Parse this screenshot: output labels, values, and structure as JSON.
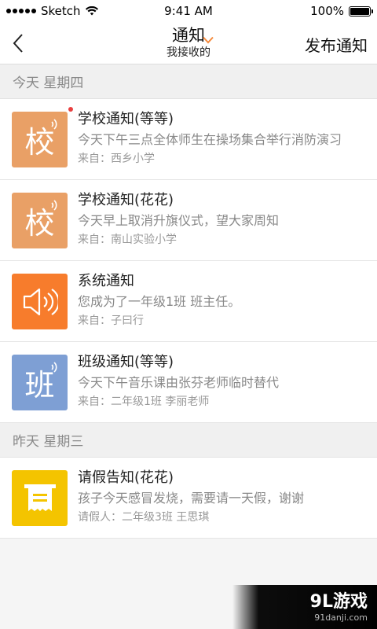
{
  "status_bar": {
    "carrier": "Sketch",
    "time": "9:41 AM",
    "battery": "100%"
  },
  "nav": {
    "title": "通知",
    "subtitle": "我接收的",
    "publish": "发布通知"
  },
  "sections": [
    {
      "header": "今天 星期四",
      "items": [
        {
          "icon_char": "校",
          "icon_color": "#e9a066",
          "has_waves": true,
          "unread": true,
          "title": "学校通知(等等)",
          "desc": "今天下午三点全体师生在操场集合举行消防演习",
          "from": "来自：西乡小学"
        },
        {
          "icon_char": "校",
          "icon_color": "#e9a066",
          "has_waves": true,
          "unread": false,
          "title": "学校通知(花花)",
          "desc": "今天早上取消升旗仪式，望大家周知",
          "from": "来自：南山实验小学"
        },
        {
          "icon_char": "",
          "icon_color": "#f77c2c",
          "icon": "speaker-icon",
          "unread": false,
          "title": "系统通知",
          "desc": "您成为了一年级1班 班主任。",
          "from": "来自：子曰行"
        },
        {
          "icon_char": "班",
          "icon_color": "#7e9fd4",
          "has_waves": true,
          "unread": false,
          "title": "班级通知(等等)",
          "desc": "今天下午音乐课由张芬老师临时替代",
          "from": "来自：二年级1班 李丽老师"
        }
      ]
    },
    {
      "header": "昨天 星期三",
      "items": [
        {
          "icon_char": "",
          "icon_color": "#f4c400",
          "icon": "leave-note-icon",
          "unread": false,
          "title": "请假告知(花花)",
          "desc": "孩子今天感冒发烧，需要请一天假，谢谢",
          "from": "请假人：二年级3班 王思琪"
        }
      ]
    }
  ],
  "watermark": {
    "main": "9L游戏",
    "sub": "91danji.com"
  }
}
